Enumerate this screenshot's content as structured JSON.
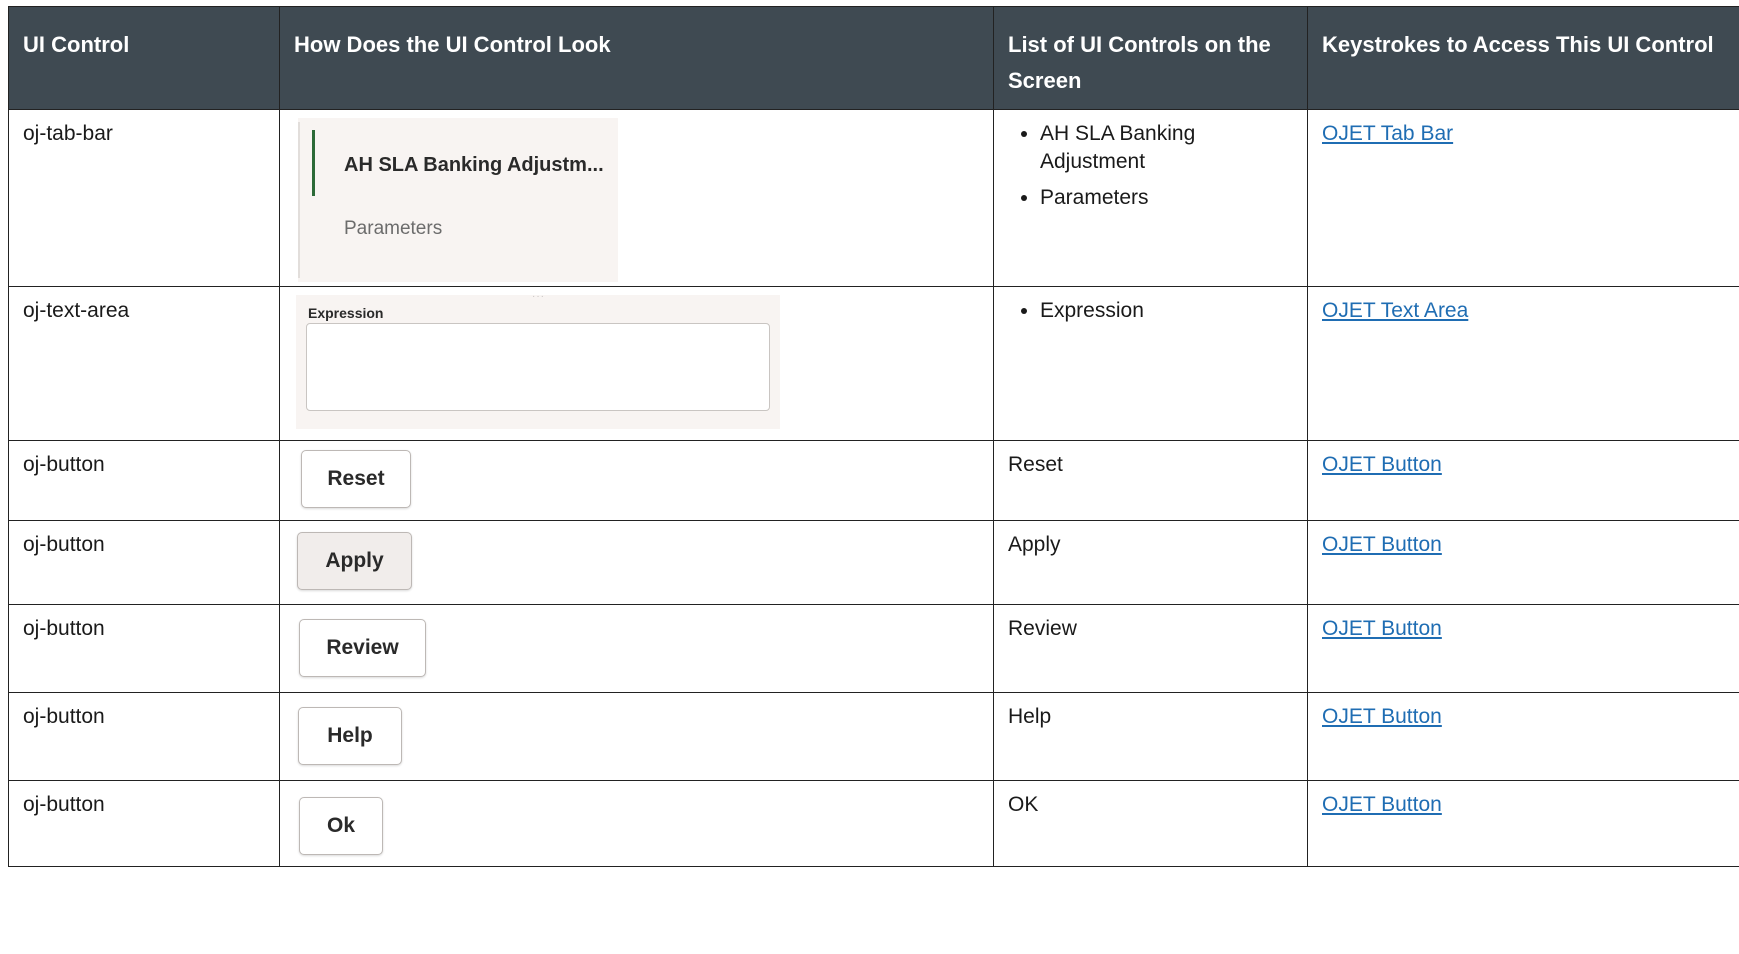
{
  "headers": {
    "control": "UI Control",
    "look": "How Does the UI Control Look",
    "list": "List of UI Controls on the Screen",
    "keys": "Keystrokes to Access This UI Control"
  },
  "rows": [
    {
      "control": "oj-tab-bar",
      "look": {
        "tabs": [
          "AH SLA Banking Adjustm...",
          "Parameters"
        ]
      },
      "list": [
        "AH SLA Banking Adjustment",
        "Parameters"
      ],
      "link": "OJET Tab Bar"
    },
    {
      "control": "oj-text-area",
      "look": {
        "label": "Expression"
      },
      "list": [
        "Expression"
      ],
      "link": "OJET Text Area"
    },
    {
      "control": "oj-button",
      "look": {
        "button": "Reset"
      },
      "list_text": "Reset",
      "link": "OJET Button"
    },
    {
      "control": "oj-button",
      "look": {
        "button": "Apply"
      },
      "list_text": "Apply",
      "link": "OJET Button"
    },
    {
      "control": "oj-button",
      "look": {
        "button": "Review"
      },
      "list_text": "Review",
      "link": "OJET Button"
    },
    {
      "control": "oj-button",
      "look": {
        "button": "Help"
      },
      "list_text": "Help",
      "link": "OJET Button"
    },
    {
      "control": "oj-button",
      "look": {
        "button": "Ok"
      },
      "list_text": "OK",
      "link": "OJET Button"
    }
  ]
}
